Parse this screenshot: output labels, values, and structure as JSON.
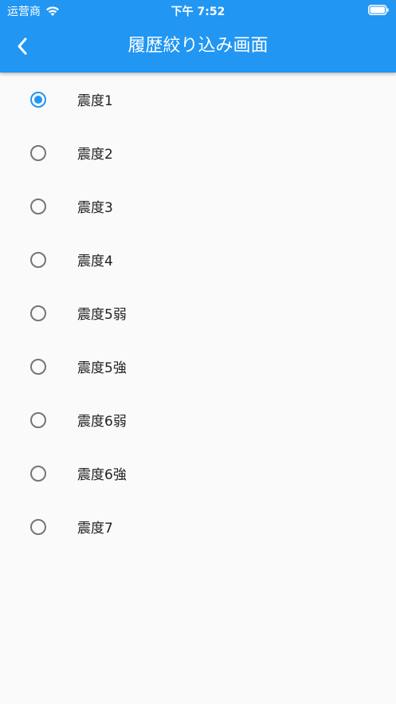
{
  "status_bar": {
    "carrier": "运营商",
    "time": "下午 7:52"
  },
  "header": {
    "title": "履歴絞り込み画面",
    "back_icon": "chevron-left-icon"
  },
  "colors": {
    "primary": "#2196f3",
    "background": "#fafafa",
    "radio_unselected": "#757575",
    "text": "#212121"
  },
  "options": [
    {
      "label": "震度1",
      "selected": true
    },
    {
      "label": "震度2",
      "selected": false
    },
    {
      "label": "震度3",
      "selected": false
    },
    {
      "label": "震度4",
      "selected": false
    },
    {
      "label": "震度5弱",
      "selected": false
    },
    {
      "label": "震度5強",
      "selected": false
    },
    {
      "label": "震度6弱",
      "selected": false
    },
    {
      "label": "震度6強",
      "selected": false
    },
    {
      "label": "震度7",
      "selected": false
    }
  ]
}
